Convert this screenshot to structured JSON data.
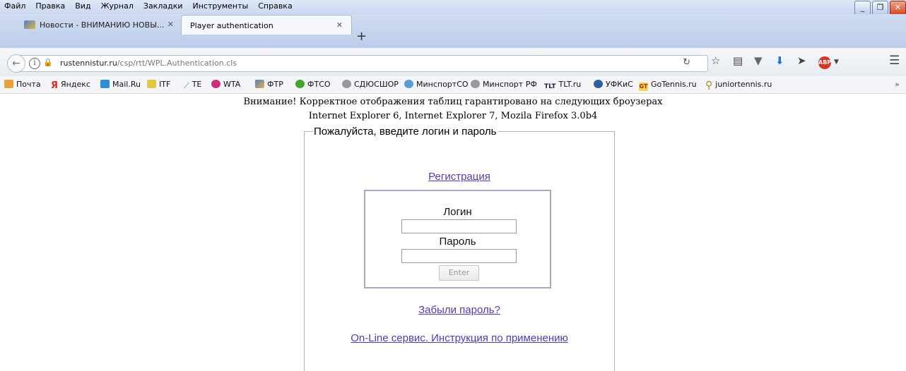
{
  "menubar": {
    "items": [
      "Файл",
      "Правка",
      "Вид",
      "Журнал",
      "Закладки",
      "Инструменты",
      "Справка"
    ]
  },
  "window_controls": {
    "minimize": "_",
    "restore": "❐",
    "close": "✕"
  },
  "tabs": [
    {
      "label": "Новости - ВНИМАНИЮ НОВЫ...",
      "active": false,
      "close": "✕"
    },
    {
      "label": "Player authentication",
      "active": true,
      "close": "✕"
    }
  ],
  "new_tab": "+",
  "nav": {
    "url_domain": "rustennistur.ru",
    "url_path": "/csp/rtt/WPL.Authentication.cls",
    "icons": [
      "back-icon",
      "info-icon",
      "insecure-lock-icon",
      "reload-icon",
      "star-icon",
      "reading-list-icon",
      "pocket-icon",
      "download-icon",
      "send-icon",
      "abp-icon",
      "menu-icon"
    ],
    "abp_label": "ABP"
  },
  "bookmarks": [
    "Почта",
    "Яндекс",
    "Mail.Ru",
    "ITF",
    "TE",
    "WTA",
    "ФТР",
    "ФТСО",
    "СДЮСШОР",
    "МинспортСО",
    "Минспорт РФ",
    "TLT.ru",
    "УФКиС",
    "GoTennis.ru",
    "juniortennis.ru"
  ],
  "bookmarks_overflow": "»",
  "page": {
    "notice_line1": "Внимание! Корректное отображения таблиц гарантировано на следующих броузерах",
    "notice_line2": "Internet Explorer 6, Internet Explorer 7, Mozila Firefox 3.0b4",
    "legend": "Пожалуйста, введите логин и пароль",
    "register_link": "Регистрация",
    "login_label": "Логин",
    "login_value": "",
    "password_label": "Пароль",
    "password_value": "",
    "enter_button": "Enter",
    "forgot_link": "Забыли пароль?",
    "online_link": "On-Line сервис. Инструкция по применению"
  },
  "colors": {
    "link": "#5539b0",
    "chrome": "#c9d7ee"
  }
}
